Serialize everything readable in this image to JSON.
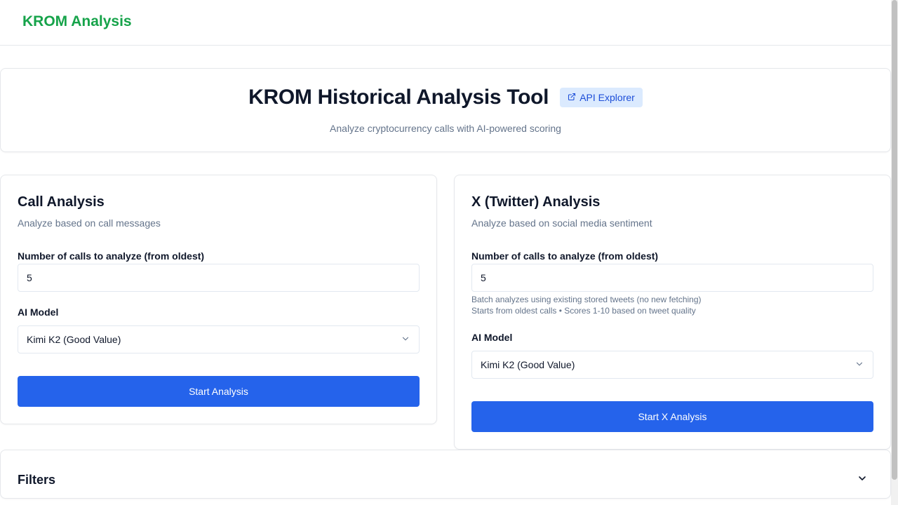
{
  "app": {
    "brand": "KROM Analysis"
  },
  "hero": {
    "title": "KROM Historical Analysis Tool",
    "api_button": "API Explorer",
    "subtitle": "Analyze cryptocurrency calls with AI-powered scoring"
  },
  "call_analysis": {
    "title": "Call Analysis",
    "subtitle": "Analyze based on call messages",
    "count_label": "Number of calls to analyze (from oldest)",
    "count_value": "5",
    "model_label": "AI Model",
    "model_value": "Kimi K2 (Good Value)",
    "start_button": "Start Analysis"
  },
  "x_analysis": {
    "title": "X (Twitter) Analysis",
    "subtitle": "Analyze based on social media sentiment",
    "count_label": "Number of calls to analyze (from oldest)",
    "count_value": "5",
    "hint_1": "Batch analyzes using existing stored tweets (no new fetching)",
    "hint_2": "Starts from oldest calls • Scores 1-10 based on tweet quality",
    "model_label": "AI Model",
    "model_value": "Kimi K2 (Good Value)",
    "start_button": "Start X Analysis"
  },
  "filters": {
    "title": "Filters"
  },
  "icons": {
    "api": "external-link-icon",
    "select": "chevron-down-icon",
    "filters": "chevron-down-icon"
  },
  "colors": {
    "brand": "#16a34a",
    "primary": "#2563eb",
    "badge_bg": "#dbeafe",
    "badge_text": "#1d4ed8",
    "muted": "#64748b"
  }
}
